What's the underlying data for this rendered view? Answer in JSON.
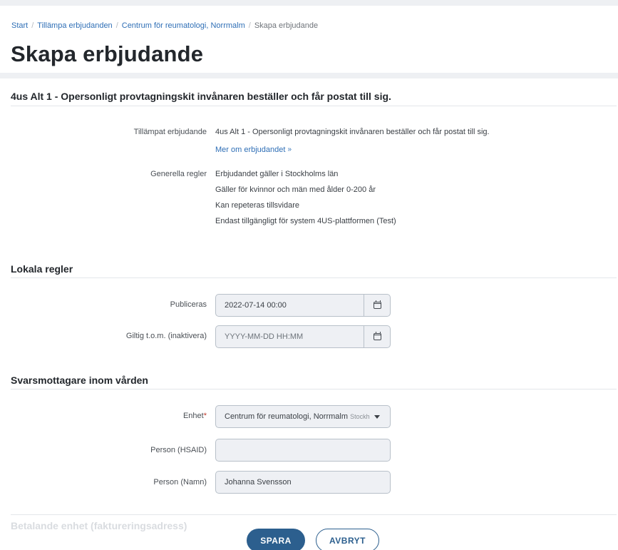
{
  "breadcrumb": {
    "items": [
      "Start",
      "Tillämpa erbjudanden",
      "Centrum för reumatologi, Norrmalm"
    ],
    "current": "Skapa erbjudande",
    "separator": "/"
  },
  "page": {
    "title": "Skapa erbjudande"
  },
  "offer": {
    "heading": "4us Alt 1 - Opersonligt provtagningskit invånaren beställer och får postat till sig.",
    "applied_label": "Tillämpat erbjudande",
    "applied_value": "4us Alt 1 - Opersonligt provtagningskit invånaren beställer och får postat till sig.",
    "more_link": "Mer om erbjudandet",
    "general_rules_label": "Generella regler",
    "general_rules": [
      "Erbjudandet gäller i Stockholms län",
      "Gäller för kvinnor och män med ålder 0-200 år",
      "Kan repeteras tillsvidare",
      "Endast tillgängligt för system 4US-plattformen (Test)"
    ]
  },
  "local_rules": {
    "heading": "Lokala regler",
    "published_label": "Publiceras",
    "published_value": "2022-07-14 00:00",
    "valid_label": "Giltig t.o.m. (inaktivera)",
    "valid_placeholder": "YYYY-MM-DD HH:MM"
  },
  "recipient": {
    "heading": "Svarsmottagare inom vården",
    "unit_label": "Enhet",
    "unit_required": "*",
    "unit_value": "Centrum för reumatologi, Norrmalm",
    "unit_suffix": "Stockh",
    "hsaid_label": "Person (HSAID)",
    "hsaid_value": "",
    "name_label": "Person (Namn)",
    "name_value": "Johanna Svensson"
  },
  "billing": {
    "heading": "Betalande enhet (faktureringsadress)"
  },
  "actions": {
    "save": "SPARA",
    "cancel": "AVBRYT"
  },
  "icons": {
    "calendar": "calendar-icon",
    "chevrons": "double-chevron-down-icon",
    "caret": "caret-down-icon"
  },
  "colors": {
    "primary": "#2c5f8e",
    "link": "#2f6fb6",
    "required": "#c0392b"
  }
}
